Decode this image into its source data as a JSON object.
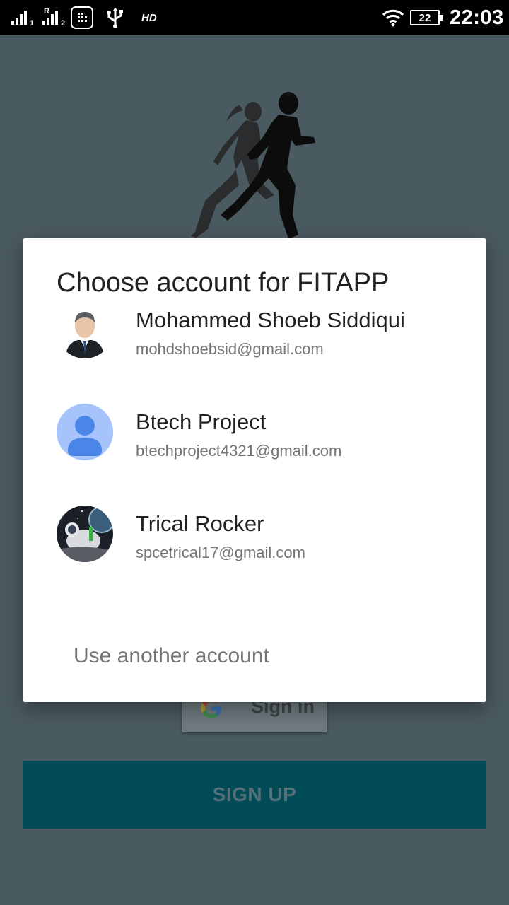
{
  "status_bar": {
    "sim1_label": "1",
    "sim2_roaming": "R",
    "sim2_label": "2",
    "network_badge": "HD",
    "battery_level": "22",
    "time": "22:03"
  },
  "background": {
    "signin_button_label": "Sign in",
    "signup_button_label": "SIGN UP",
    "signup_color": "#004b55"
  },
  "dialog": {
    "title": "Choose account for FITAPP",
    "accounts": [
      {
        "name": "Mohammed Shoeb Siddiqui",
        "email": "mohdshoebsid@gmail.com",
        "avatar": "businessman-avatar"
      },
      {
        "name": "Btech Project",
        "email": "btechproject4321@gmail.com",
        "avatar": "default-person-avatar"
      },
      {
        "name": "Trical Rocker",
        "email": "spcetrical17@gmail.com",
        "avatar": "astronaut-avatar"
      }
    ],
    "use_another_label": "Use another account",
    "default_avatar_color": "#a6c4fb"
  }
}
